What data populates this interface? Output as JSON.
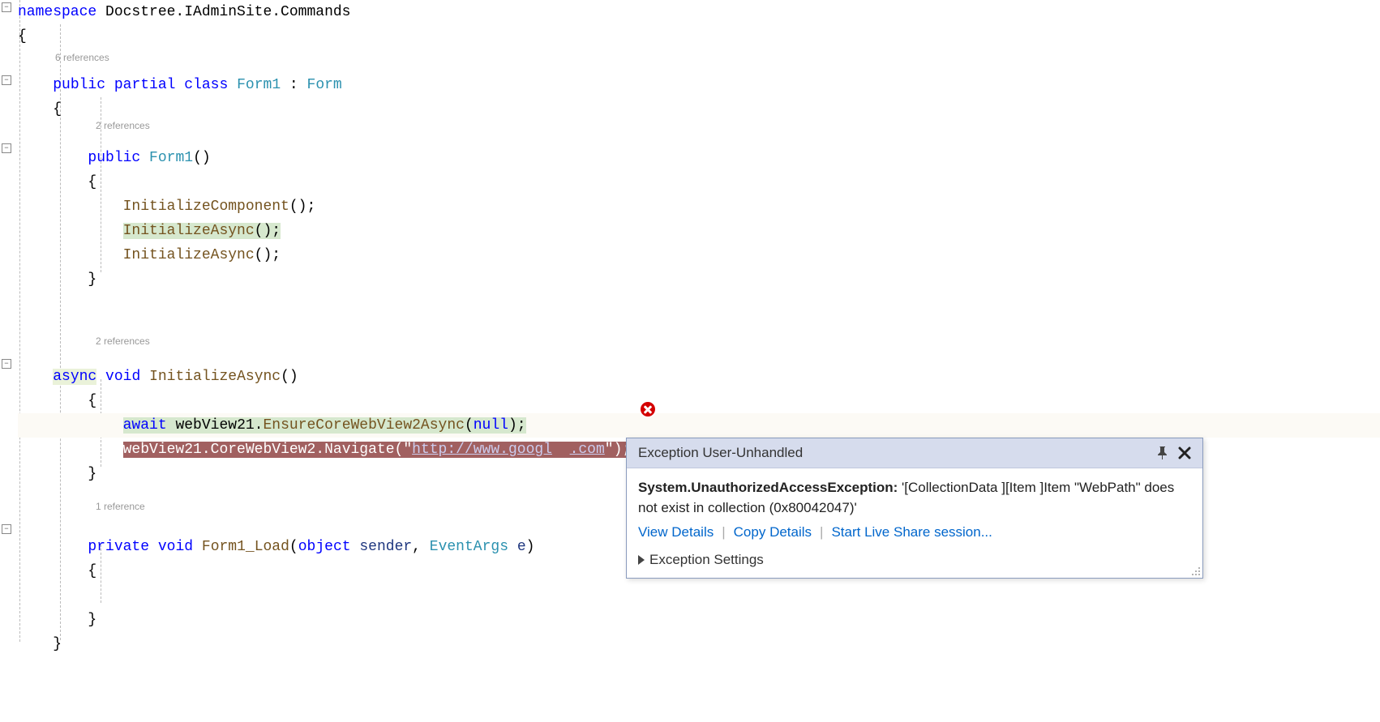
{
  "codelens": {
    "ns_refs": "6 references",
    "ctor_refs": "2 references",
    "init_refs": "2 references",
    "load_refs": "1 reference"
  },
  "code": {
    "ns_kw": "namespace",
    "ns_name": " Docstree.IAdminSite.Commands",
    "brace_open": "{",
    "brace_close": "}",
    "indent1": "    ",
    "indent2": "        ",
    "indent3": "            ",
    "public_kw": "public",
    "partial_kw": "partial",
    "class_kw": "class",
    "async_kw": "async",
    "void_kw": "void",
    "private_kw": "private",
    "await_kw": "await",
    "null_kw": "null",
    "form1": "Form1",
    "form": "Form",
    "colon": " : ",
    "ctor_sig": "()",
    "init_component": "InitializeComponent",
    "init_async": "InitializeAsync",
    "empty_parens_semi": "();",
    "ensure_method": "EnsureCoreWebView2Async",
    "navigate_method": "Navigate",
    "webview": "webView21",
    "corewv": "CoreWebView2",
    "dot": ".",
    "lparen": "(",
    "rparen_semi": ");",
    "form_load": "Form1_Load",
    "object_kw": "object",
    "sender": "sender",
    "eventargs": "EventArgs",
    "e_param": "e",
    "comma_sp": ", ",
    "url": "http://www.google.com",
    "url_vis1": "http://www.googl",
    "url_vis2": ".com",
    "quote": "\"",
    "rparen": ")",
    "space": " "
  },
  "exception": {
    "title": "Exception User-Unhandled",
    "type_bold": "System.UnauthorizedAccessException:",
    "message": " '[CollectionData ][Item ]Item \"WebPath\" does not exist in collection  (0x80042047)'",
    "view_details": "View Details",
    "copy_details": "Copy Details",
    "live_share": "Start Live Share session...",
    "settings": "Exception Settings",
    "sep": "|"
  }
}
